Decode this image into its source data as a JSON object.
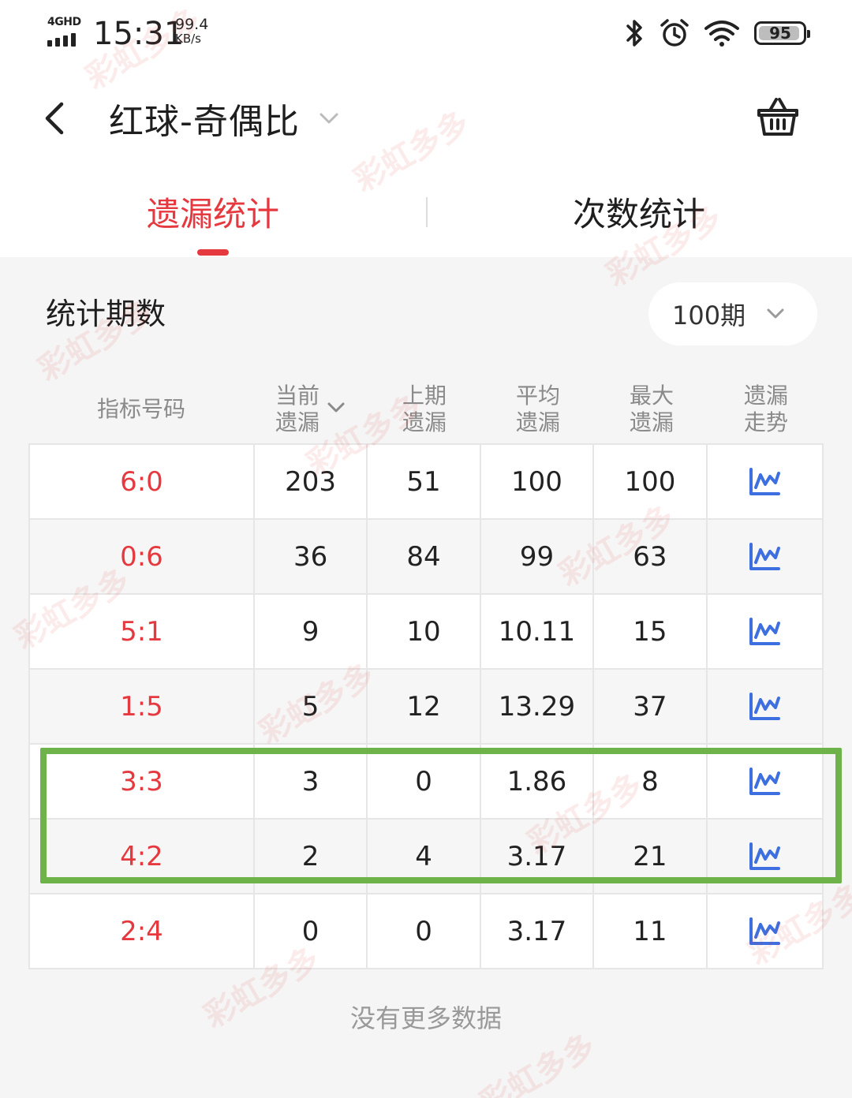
{
  "status_bar": {
    "network": "4GHD",
    "time": "15:31",
    "speed_value": "99.4",
    "speed_unit": "KB/s",
    "battery": "95",
    "battery_fraction": 0.95,
    "icons": [
      "bluetooth-icon",
      "alarm-icon",
      "wifi-icon",
      "battery-icon"
    ]
  },
  "header": {
    "title": "红球-奇偶比",
    "icons": [
      "back-arrow-icon",
      "chevron-down-icon",
      "basket-icon"
    ]
  },
  "tabs": [
    {
      "label": "遗漏统计",
      "active": true
    },
    {
      "label": "次数统计",
      "active": false
    }
  ],
  "period": {
    "label": "统计期数",
    "value": "100期"
  },
  "table": {
    "headers": [
      {
        "line1": "指标号码",
        "line2": ""
      },
      {
        "line1": "当前",
        "line2": "遗漏"
      },
      {
        "line1": "上期",
        "line2": "遗漏"
      },
      {
        "line1": "平均",
        "line2": "遗漏"
      },
      {
        "line1": "最大",
        "line2": "遗漏"
      },
      {
        "line1": "遗漏",
        "line2": "走势"
      }
    ],
    "rows": [
      {
        "code": "6:0",
        "current": "203",
        "last": "51",
        "avg": "100",
        "max": "100"
      },
      {
        "code": "0:6",
        "current": "36",
        "last": "84",
        "avg": "99",
        "max": "63"
      },
      {
        "code": "5:1",
        "current": "9",
        "last": "10",
        "avg": "10.11",
        "max": "15"
      },
      {
        "code": "1:5",
        "current": "5",
        "last": "12",
        "avg": "13.29",
        "max": "37"
      },
      {
        "code": "3:3",
        "current": "3",
        "last": "0",
        "avg": "1.86",
        "max": "8"
      },
      {
        "code": "4:2",
        "current": "2",
        "last": "4",
        "avg": "3.17",
        "max": "21"
      },
      {
        "code": "2:4",
        "current": "0",
        "last": "0",
        "avg": "3.17",
        "max": "11"
      }
    ]
  },
  "footer": {
    "no_more": "没有更多数据"
  },
  "watermark": {
    "text": "彩虹多多"
  },
  "colors": {
    "accent": "#e5393f",
    "trend_icon": "#3d6fe0",
    "highlight": "#6eb24a"
  }
}
